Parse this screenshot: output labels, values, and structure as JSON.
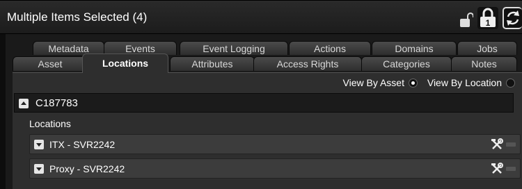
{
  "header": {
    "title": "Multiple Items Selected (4)"
  },
  "tabs": {
    "row1": [
      "Metadata",
      "Events",
      "Event Logging",
      "Actions",
      "Domains",
      "Jobs"
    ],
    "row2": [
      "Asset",
      "Locations",
      "Attributes",
      "Access Rights",
      "Categories",
      "Notes"
    ],
    "active": "Locations"
  },
  "view": {
    "by_asset": "View By Asset",
    "by_location": "View By Location",
    "selected": "View By Asset"
  },
  "asset": {
    "name": "C187783"
  },
  "locations": {
    "label": "Locations",
    "items": [
      {
        "name": "ITX - SVR2242"
      },
      {
        "name": "Proxy - SVR2242"
      }
    ]
  },
  "icons": {
    "header": [
      "unlock-icon",
      "lock-icon",
      "refresh-icon"
    ],
    "row": [
      "tools-icon",
      "minus-icon"
    ]
  }
}
